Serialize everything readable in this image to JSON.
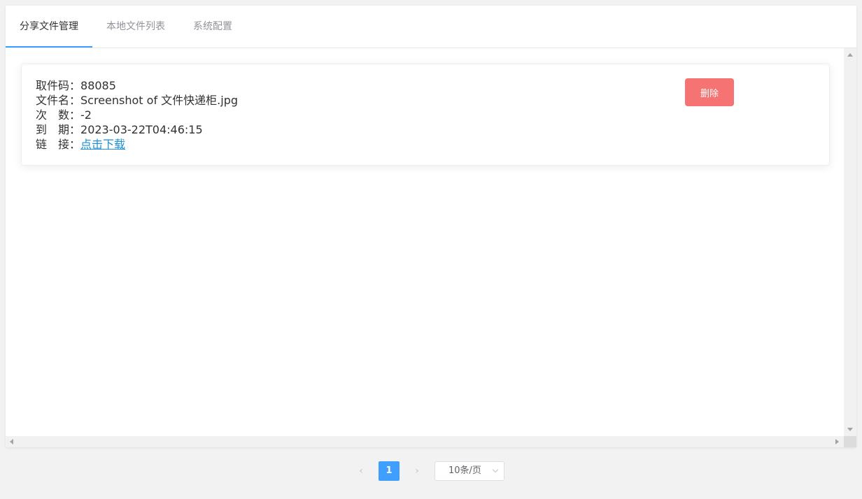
{
  "tabs": [
    "分享文件管理",
    "本地文件列表",
    "系统配置"
  ],
  "file": {
    "code_label": "取件码：",
    "code": "88085",
    "name_label": "文件名：",
    "name": "Screenshot of 文件快递柜.jpg",
    "count_label": "次　数：",
    "count": "-2",
    "expire_label": "到　期：",
    "expire": "2023-03-22T04:46:15",
    "link_label": "链　接：",
    "link_text": "点击下载"
  },
  "delete_label": "删除",
  "pagination": {
    "prev_icon": "‹",
    "current_page": "1",
    "next_icon": "›",
    "page_size": "10条/页"
  },
  "colors": {
    "accent": "#409eff",
    "danger": "#f56c6c",
    "link": "#1e8fd6"
  }
}
